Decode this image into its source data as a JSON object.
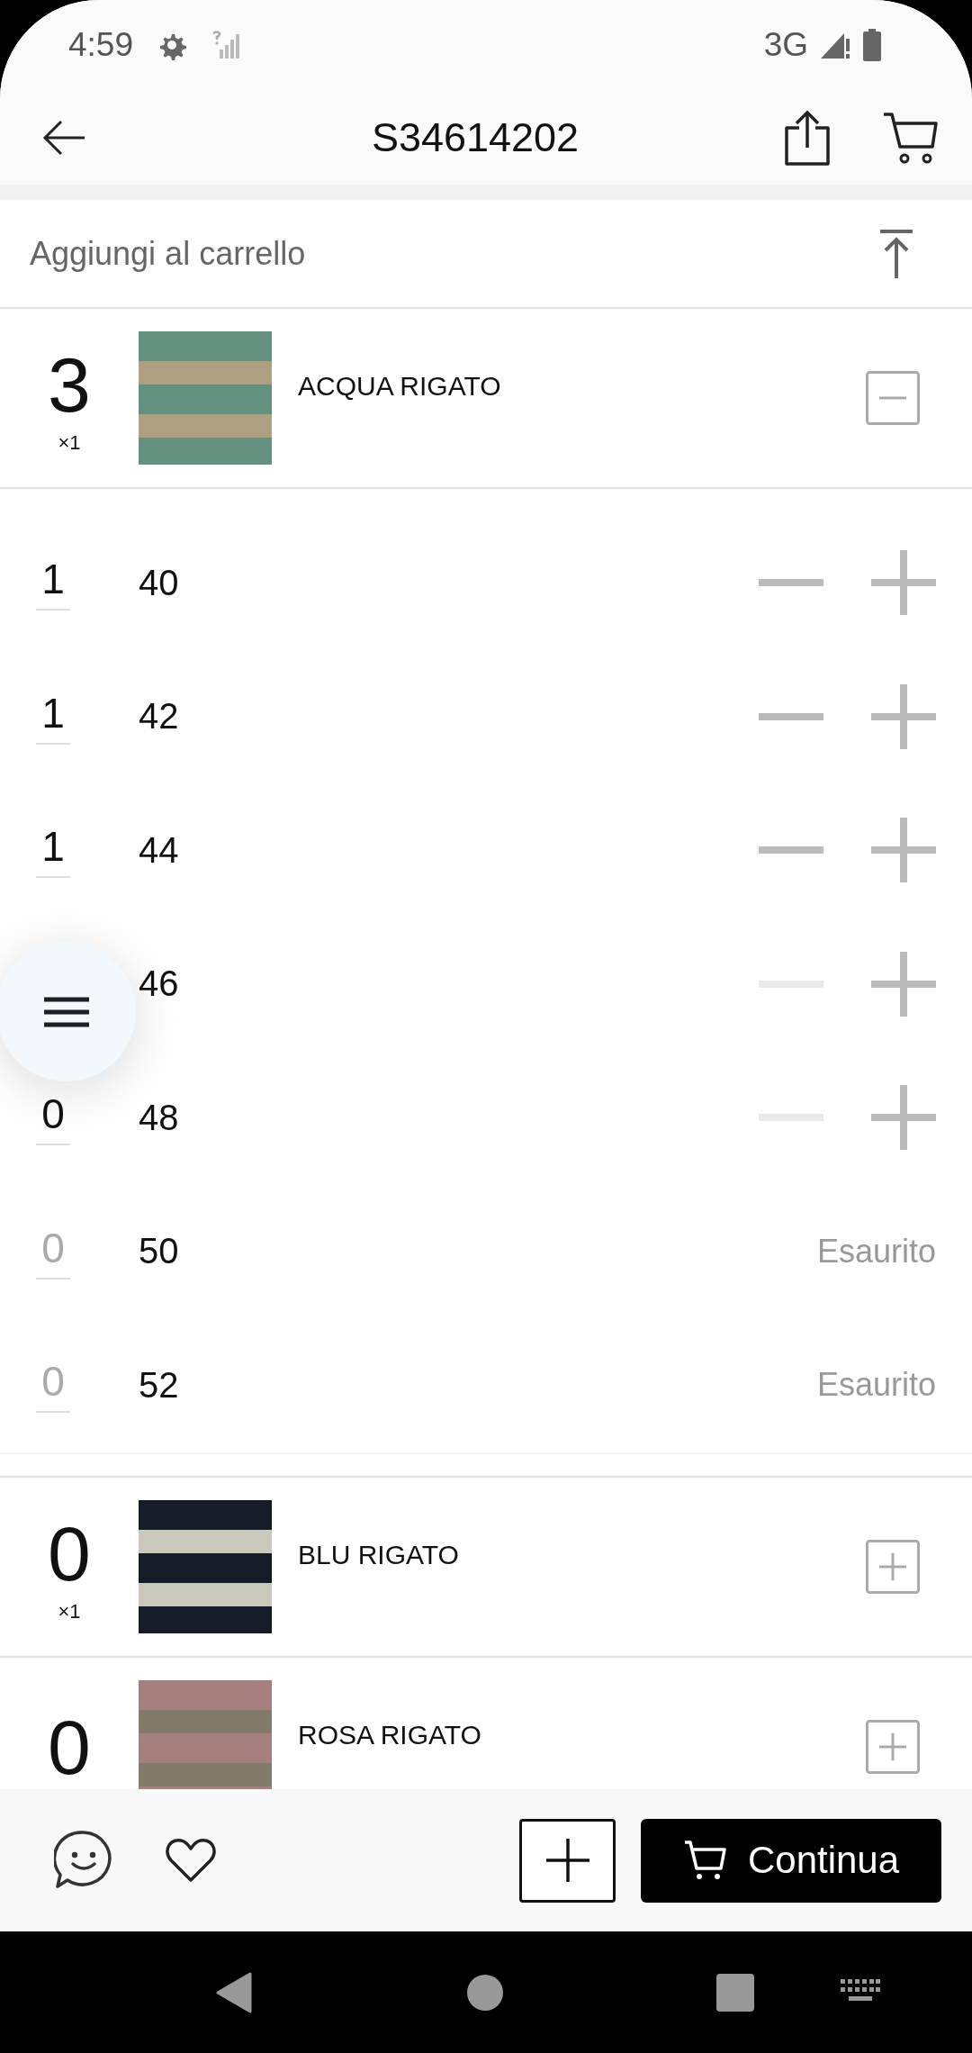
{
  "status_bar": {
    "time": "4:59",
    "network": "3G"
  },
  "app_bar": {
    "title": "S34614202"
  },
  "section": {
    "title": "Aggiungi al carrello"
  },
  "products": [
    {
      "name": "ACQUA RIGATO",
      "quantity": "3",
      "multiplier": "×1",
      "expanded": true,
      "sizes": [
        {
          "kind": "stepper",
          "quantity": "1",
          "size": "40",
          "minus_disabled": false
        },
        {
          "kind": "stepper",
          "quantity": "1",
          "size": "42",
          "minus_disabled": false
        },
        {
          "kind": "stepper",
          "quantity": "1",
          "size": "44",
          "minus_disabled": false
        },
        {
          "kind": "stepper",
          "size": "46",
          "minus_disabled": true
        },
        {
          "kind": "stepper",
          "quantity": "0",
          "size": "48",
          "minus_disabled": true
        },
        {
          "kind": "sold_out",
          "quantity": "0",
          "size": "50",
          "status": "Esaurito"
        },
        {
          "kind": "sold_out",
          "quantity": "0",
          "size": "52",
          "status": "Esaurito"
        }
      ]
    },
    {
      "name": "BLU RIGATO",
      "quantity": "0",
      "multiplier": "×1",
      "expanded": false
    },
    {
      "name": "ROSA RIGATO",
      "quantity": "0",
      "expanded": false
    }
  ],
  "bottom_bar": {
    "button": "Continua"
  }
}
